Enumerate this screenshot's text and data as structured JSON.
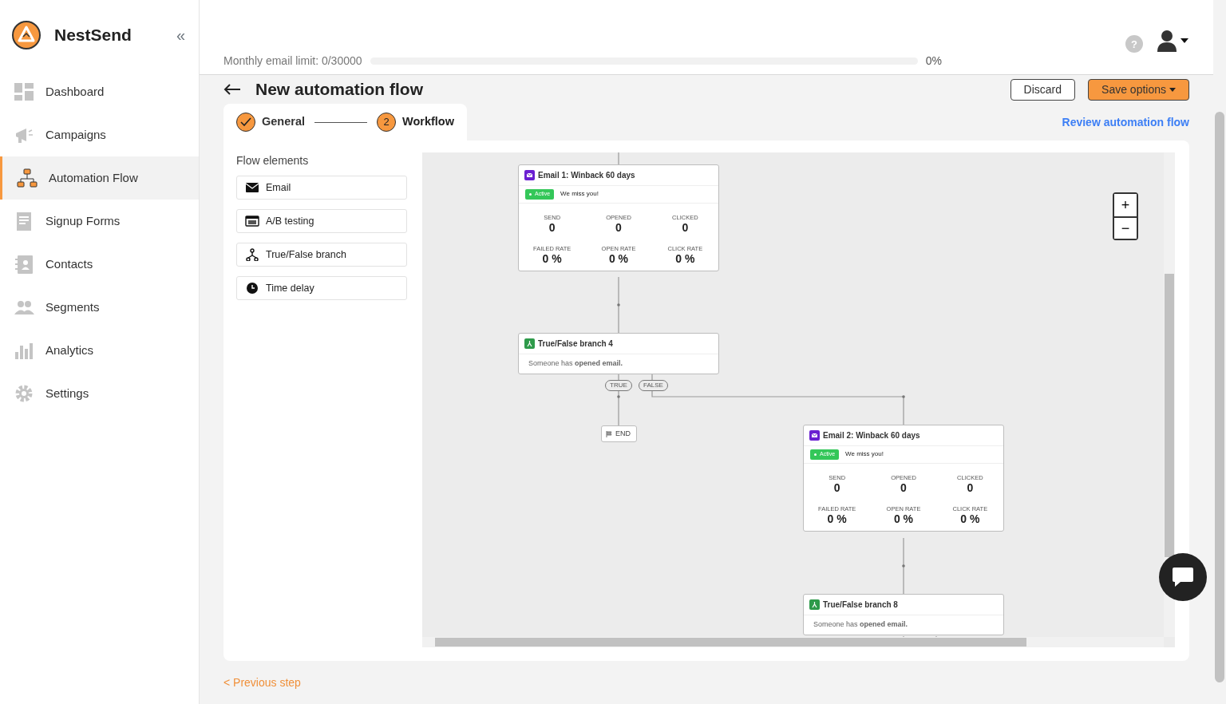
{
  "brand": {
    "name": "NestSend",
    "collapse_label": "«"
  },
  "sidebar": {
    "items": [
      {
        "label": "Dashboard",
        "selected": false
      },
      {
        "label": "Campaigns",
        "selected": false
      },
      {
        "label": "Automation Flow",
        "selected": true
      },
      {
        "label": "Signup Forms",
        "selected": false
      },
      {
        "label": "Contacts",
        "selected": false
      },
      {
        "label": "Segments",
        "selected": false
      },
      {
        "label": "Analytics",
        "selected": false
      },
      {
        "label": "Settings",
        "selected": false
      }
    ]
  },
  "header": {
    "limit_label": "Monthly email limit: 0/30000",
    "level": 0,
    "percent": "0%",
    "help_label": "?"
  },
  "page": {
    "title": "New automation flow",
    "buttons": [
      {
        "label": "Discard",
        "kind": "outline"
      },
      {
        "label": "Save options",
        "kind": "primary"
      }
    ]
  },
  "steps": [
    {
      "label": "General",
      "completed": true,
      "selected": false
    },
    {
      "label": "Workflow",
      "completed": false,
      "number": "2",
      "selected": true
    }
  ],
  "review_link": "Review automation flow",
  "flow_elements": {
    "title": "Flow elements",
    "items": [
      {
        "label": "Email"
      },
      {
        "label": "A/B testing"
      },
      {
        "label": "True/False branch"
      },
      {
        "label": "Time delay"
      }
    ]
  },
  "canvas": {
    "nodes": [
      {
        "kind": "email",
        "title": "Email 1: Winback 60 days",
        "status": "Active",
        "subject": "We miss you!",
        "stats": [
          {
            "label": "SEND",
            "value": "0"
          },
          {
            "label": "OPENED",
            "value": "0"
          },
          {
            "label": "CLICKED",
            "value": "0"
          },
          {
            "label": "FAILED RATE",
            "value": "0 %"
          },
          {
            "label": "OPEN RATE",
            "value": "0 %"
          },
          {
            "label": "CLICK RATE",
            "value": "0 %"
          }
        ]
      },
      {
        "kind": "branch",
        "title": "True/False branch 4",
        "condition": "Someone has **opened email.**"
      },
      {
        "kind": "end",
        "title": "END"
      },
      {
        "kind": "email",
        "title": "Email 2: Winback 60 days",
        "status": "Active",
        "subject": "We miss you!",
        "stats": [
          {
            "label": "SEND",
            "value": "0"
          },
          {
            "label": "OPENED",
            "value": "0"
          },
          {
            "label": "CLICKED",
            "value": "0"
          },
          {
            "label": "FAILED RATE",
            "value": "0 %"
          },
          {
            "label": "OPEN RATE",
            "value": "0 %"
          },
          {
            "label": "CLICK RATE",
            "value": "0 %"
          }
        ]
      },
      {
        "kind": "branch",
        "title": "True/False branch 8",
        "condition": "Someone has **opened email.**"
      }
    ],
    "branch_labels": [
      "TRUE",
      "FALSE"
    ],
    "zoom_in": "+",
    "zoom_out": "−"
  },
  "previous_step": "< Previous step"
}
